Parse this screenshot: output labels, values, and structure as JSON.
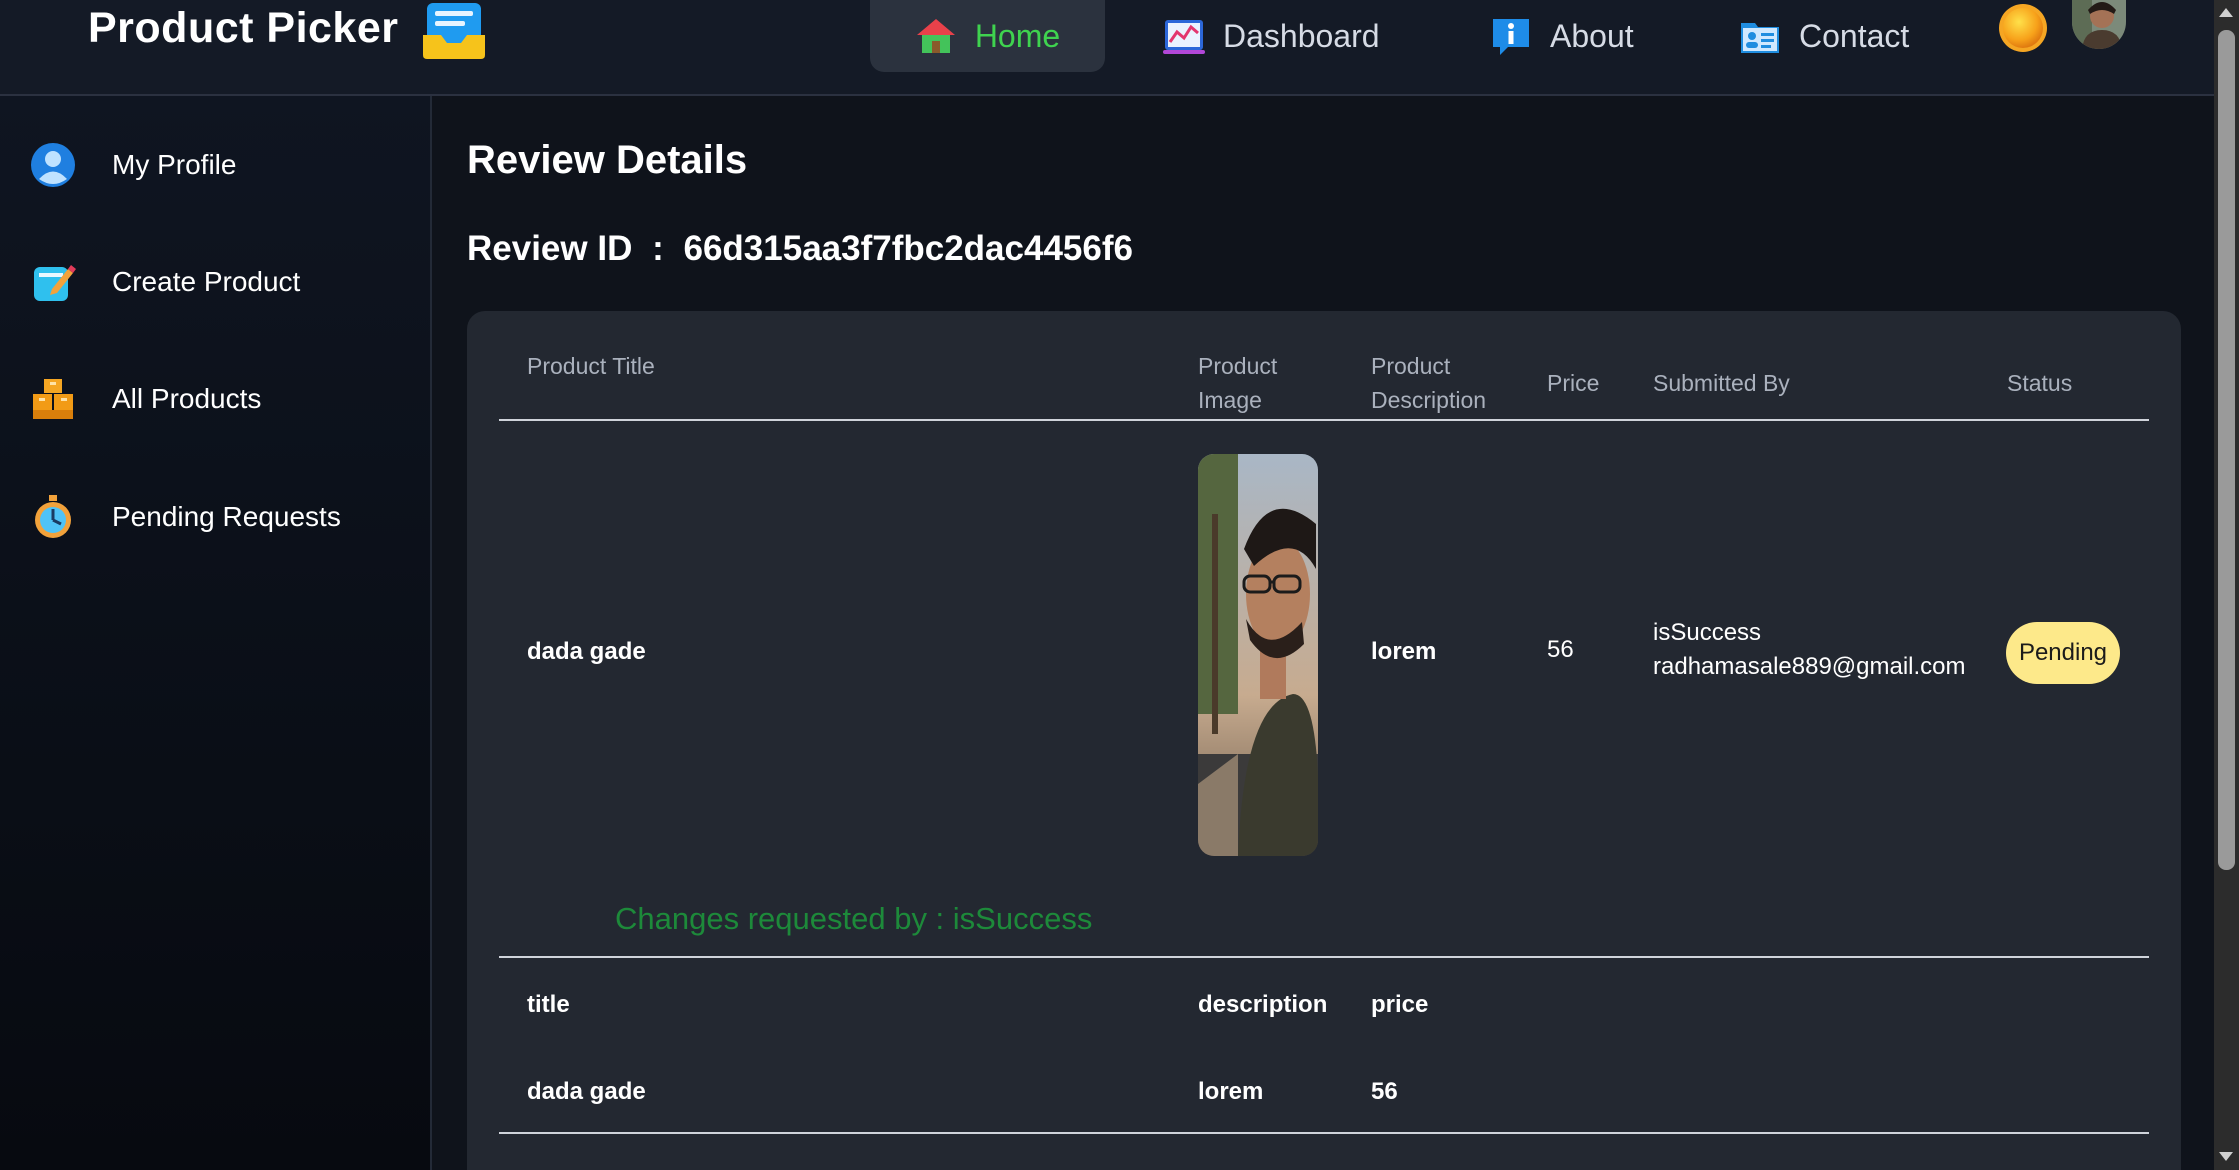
{
  "app": {
    "brand_title": "Product Picker",
    "brand_icon": "inbox-tray-icon"
  },
  "nav": {
    "items": [
      {
        "label": "Home",
        "icon": "house-icon",
        "active": true
      },
      {
        "label": "Dashboard",
        "icon": "line-chart-icon",
        "active": false
      },
      {
        "label": "About",
        "icon": "info-icon",
        "active": false
      },
      {
        "label": "Contact",
        "icon": "contact-card-icon",
        "active": false
      }
    ],
    "theme_toggle_icon": "sun-icon",
    "avatar_icon": "user-avatar"
  },
  "sidebar": {
    "items": [
      {
        "label": "My Profile",
        "icon": "user-icon"
      },
      {
        "label": "Create Product",
        "icon": "edit-note-icon"
      },
      {
        "label": "All Products",
        "icon": "boxes-icon"
      },
      {
        "label": "Pending Requests",
        "icon": "stopwatch-icon"
      }
    ]
  },
  "main": {
    "page_title": "Review Details",
    "review_id_label": "Review ID",
    "review_id_sep": ":",
    "review_id_value": "66d315aa3f7fbc2dac4456f6"
  },
  "table": {
    "headers": {
      "product_title": "Product Title",
      "product_image_1": "Product",
      "product_image_2": "Image",
      "product_description_1": "Product",
      "product_description_2": "Description",
      "price": "Price",
      "submitted_by": "Submitted By",
      "status": "Status"
    },
    "row": {
      "product_title": "dada gade",
      "product_description": "lorem",
      "price": "56",
      "submitted_by_name": "isSuccess",
      "submitted_by_email": "radhamasale889@gmail.com",
      "status": "Pending"
    }
  },
  "changes": {
    "label": "Changes requested by : isSuccess",
    "headers": {
      "title": "title",
      "description": "description",
      "price": "price"
    },
    "values": {
      "title": "dada gade",
      "description": "lorem",
      "price": "56"
    }
  },
  "colors": {
    "background": "#0f131b",
    "topbar": "#141a26",
    "card": "#232831",
    "active_nav_text": "#3fd34f",
    "changes_text": "#1d8a3a",
    "pending_badge": "#fde98a"
  }
}
